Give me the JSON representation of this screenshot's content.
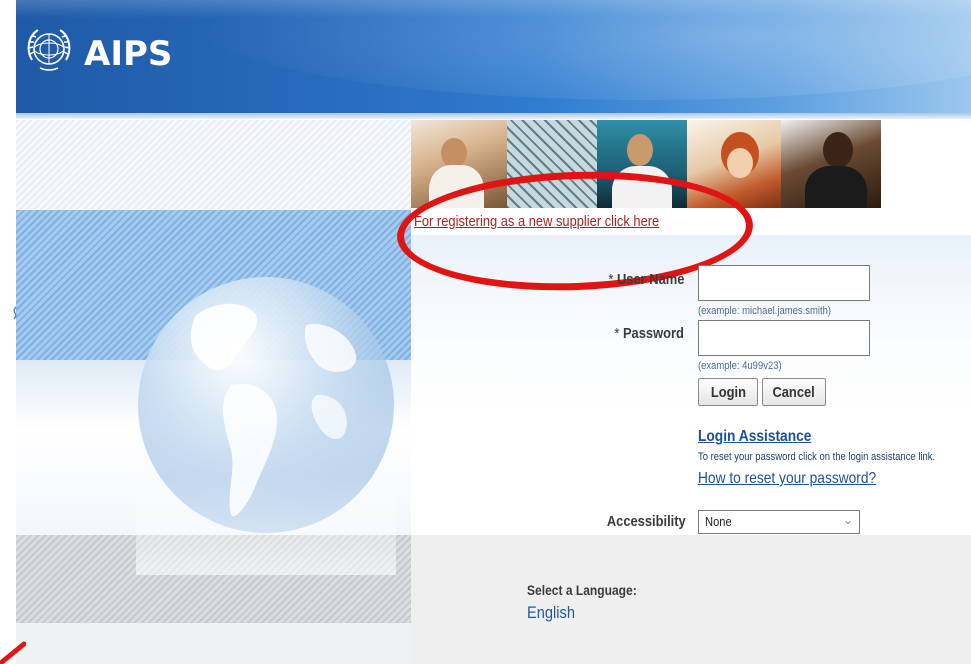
{
  "header": {
    "logo_text": "AIPS",
    "colors": {
      "banner_dark": "#1e5aa7",
      "banner_light": "#9cc7ee"
    }
  },
  "register": {
    "link_text": "For registering as a new supplier click here",
    "highlight_color": "#e11414"
  },
  "form": {
    "username": {
      "required_mark": "*",
      "label": "User Name",
      "value": "",
      "hint": "(example: michael.james.smith)"
    },
    "password": {
      "required_mark": "*",
      "label": "Password",
      "value": "",
      "hint": "(example: 4u99v23)"
    },
    "login_button": "Login",
    "cancel_button": "Cancel"
  },
  "assistance": {
    "title": "Login Assistance",
    "description": "To reset your password click on the login assistance link.",
    "reset_link": "How to reset your password?"
  },
  "accessibility": {
    "label": "Accessibility",
    "selected": "None"
  },
  "language": {
    "title": "Select a Language:",
    "english": "English"
  }
}
